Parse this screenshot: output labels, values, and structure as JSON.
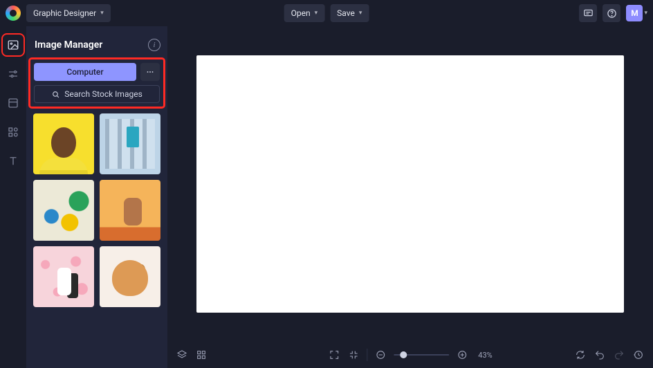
{
  "header": {
    "workspace_label": "Graphic Designer",
    "open_label": "Open",
    "save_label": "Save",
    "user_initial": "M"
  },
  "panel": {
    "title": "Image Manager",
    "computer_label": "Computer",
    "stock_label": "Search Stock Images"
  },
  "thumbnails": [
    {
      "name": "portrait-woman-yellow"
    },
    {
      "name": "building-facade-teal-door"
    },
    {
      "name": "bicycle-mural"
    },
    {
      "name": "man-desert"
    },
    {
      "name": "wedding-couple-blossoms"
    },
    {
      "name": "shiba-dog"
    }
  ],
  "footer": {
    "zoom_label": "43%",
    "zoom_value": 43
  }
}
